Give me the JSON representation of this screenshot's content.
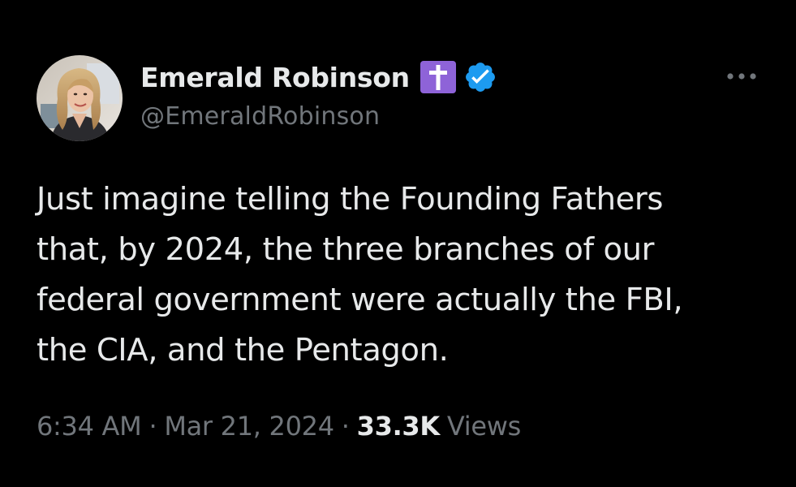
{
  "author": {
    "display_name": "Emerald Robinson",
    "handle": "@EmeraldRobinson",
    "avatar_icon": "profile-photo",
    "badges": [
      "cross-icon",
      "verified-icon"
    ]
  },
  "menu": {
    "more_icon": "ellipsis-icon"
  },
  "tweet": {
    "lines": [
      "Just imagine telling the Founding Fathers",
      "that, by 2024, the three branches of our",
      "federal government were actually the FBI,",
      "the CIA, and the Pentagon."
    ]
  },
  "meta": {
    "time": "6:34 AM",
    "separator": "·",
    "date": "Mar 21, 2024",
    "views_count": "33.3K",
    "views_label": "Views"
  },
  "colors": {
    "background": "#000000",
    "text_primary": "#e7e9ea",
    "text_secondary": "#71767b",
    "verified_blue": "#1d9bf0",
    "cross_badge_purple": "#8e63d8"
  }
}
